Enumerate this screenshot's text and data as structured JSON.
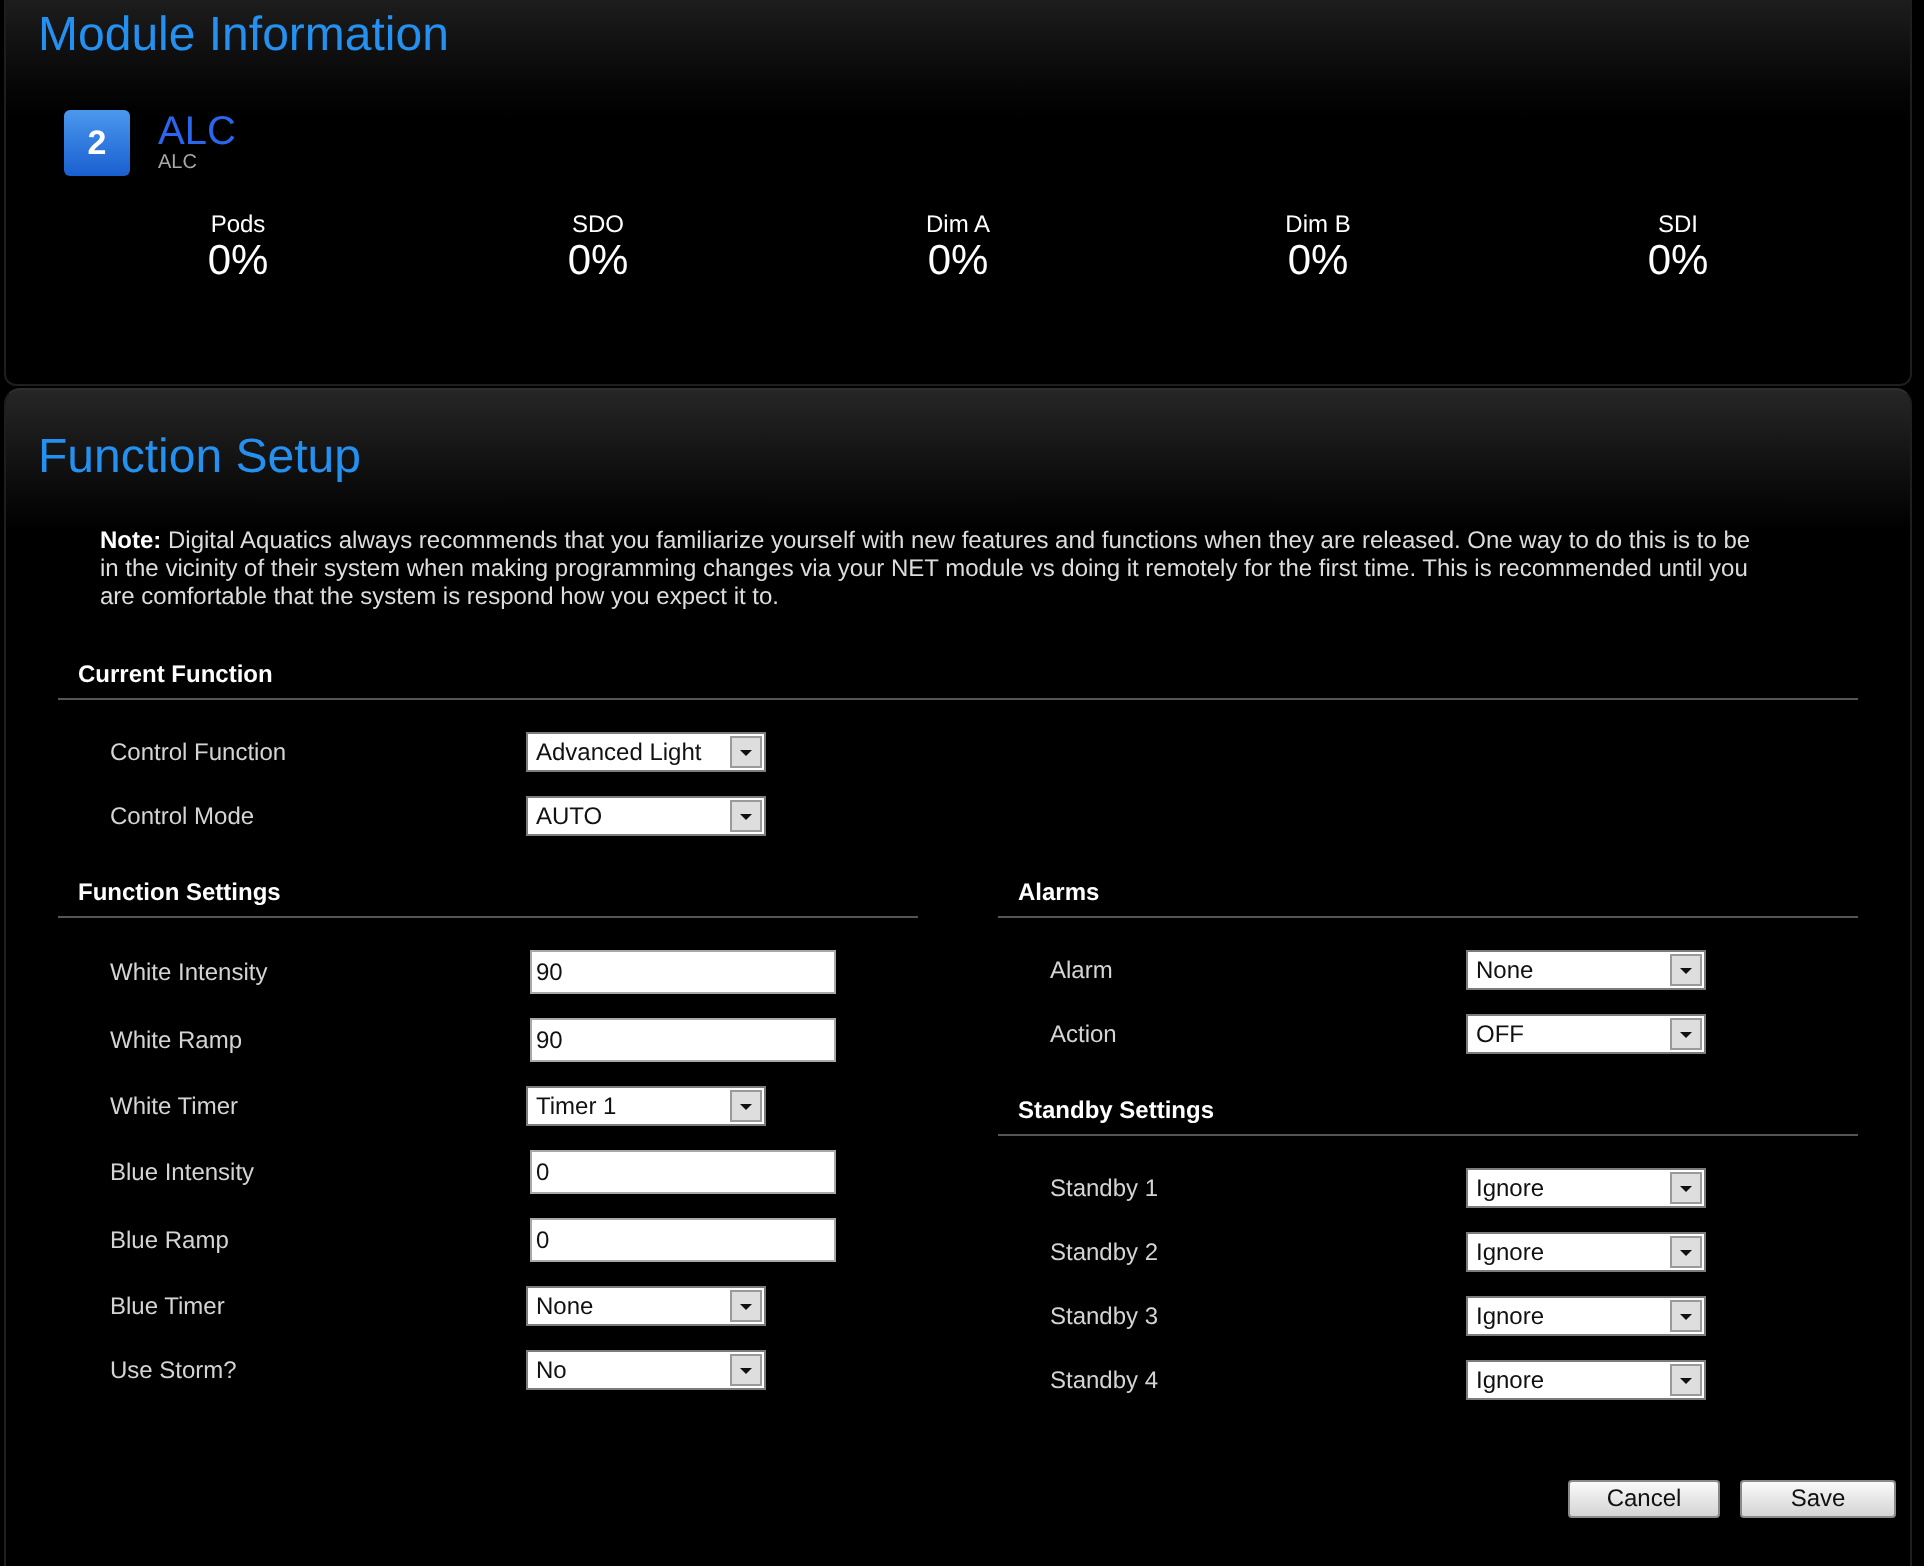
{
  "module_info": {
    "title": "Module Information",
    "badge": "2",
    "name": "ALC",
    "subtitle": "ALC",
    "stats": [
      {
        "label": "Pods",
        "value": "0%"
      },
      {
        "label": "SDO",
        "value": "0%"
      },
      {
        "label": "Dim A",
        "value": "0%"
      },
      {
        "label": "Dim B",
        "value": "0%"
      },
      {
        "label": "SDI",
        "value": "0%"
      }
    ]
  },
  "function_setup": {
    "title": "Function Setup",
    "note": "**Note:** Digital Aquatics always recommends that you familiarize yourself with new features and functions when they are released. One way to do this is to be in the vicinity of their system when making programming changes via your NET module vs doing it remotely for the first time. This is recommended until you are comfortable that the system is respond how you expect it to.",
    "current_function": {
      "heading": "Current Function",
      "fields": [
        {
          "label": "Control Function",
          "kind": "select",
          "value": "Advanced Light"
        },
        {
          "label": "Control Mode",
          "kind": "select",
          "value": "AUTO"
        }
      ]
    },
    "function_settings": {
      "heading": "Function Settings",
      "fields": [
        {
          "label": "White Intensity",
          "kind": "input",
          "value": "90"
        },
        {
          "label": "White Ramp",
          "kind": "input",
          "value": "90"
        },
        {
          "label": "White Timer",
          "kind": "select",
          "value": "Timer 1"
        },
        {
          "label": "Blue Intensity",
          "kind": "input",
          "value": "0"
        },
        {
          "label": "Blue Ramp",
          "kind": "input",
          "value": "0"
        },
        {
          "label": "Blue Timer",
          "kind": "select",
          "value": "None"
        },
        {
          "label": "Use Storm?",
          "kind": "select",
          "value": "No"
        }
      ]
    },
    "alarms": {
      "heading": "Alarms",
      "fields": [
        {
          "label": "Alarm",
          "kind": "select",
          "value": "None"
        },
        {
          "label": "Action",
          "kind": "select",
          "value": "OFF"
        }
      ]
    },
    "standby_settings": {
      "heading": "Standby Settings",
      "fields": [
        {
          "label": "Standby 1",
          "kind": "select",
          "value": "Ignore"
        },
        {
          "label": "Standby 2",
          "kind": "select",
          "value": "Ignore"
        },
        {
          "label": "Standby 3",
          "kind": "select",
          "value": "Ignore"
        },
        {
          "label": "Standby 4",
          "kind": "select",
          "value": "Ignore"
        }
      ]
    }
  },
  "buttons": [
    {
      "label": "Cancel"
    },
    {
      "label": "Save"
    }
  ]
}
